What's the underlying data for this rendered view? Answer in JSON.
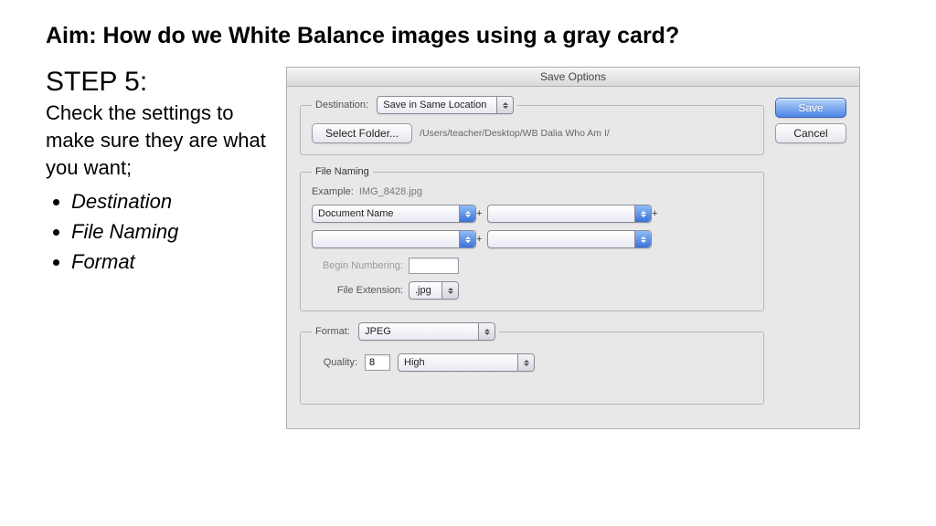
{
  "aim": "Aim: How do we White Balance images using a gray card?",
  "step": {
    "title": "STEP 5:",
    "desc": "Check the settings to make sure they are what you want;",
    "bullets": [
      "Destination",
      "File Naming",
      "Format"
    ]
  },
  "dialog": {
    "title": "Save Options",
    "save": "Save",
    "cancel": "Cancel",
    "destination": {
      "legend": "Destination:",
      "mode": "Save in Same Location",
      "select_folder": "Select Folder...",
      "path": "/Users/teacher/Desktop/WB Dalia Who Am I/"
    },
    "naming": {
      "legend": "File Naming",
      "example_label": "Example:",
      "example_value": "IMG_8428.jpg",
      "slot1": "Document Name",
      "slot2": "",
      "slot3": "",
      "slot4": "",
      "begin_numbering_label": "Begin Numbering:",
      "begin_numbering_value": "",
      "file_ext_label": "File Extension:",
      "file_ext": ".jpg"
    },
    "format": {
      "legend": "Format:",
      "format": "JPEG",
      "quality_label": "Quality:",
      "quality_value": "8",
      "quality_preset": "High"
    }
  }
}
